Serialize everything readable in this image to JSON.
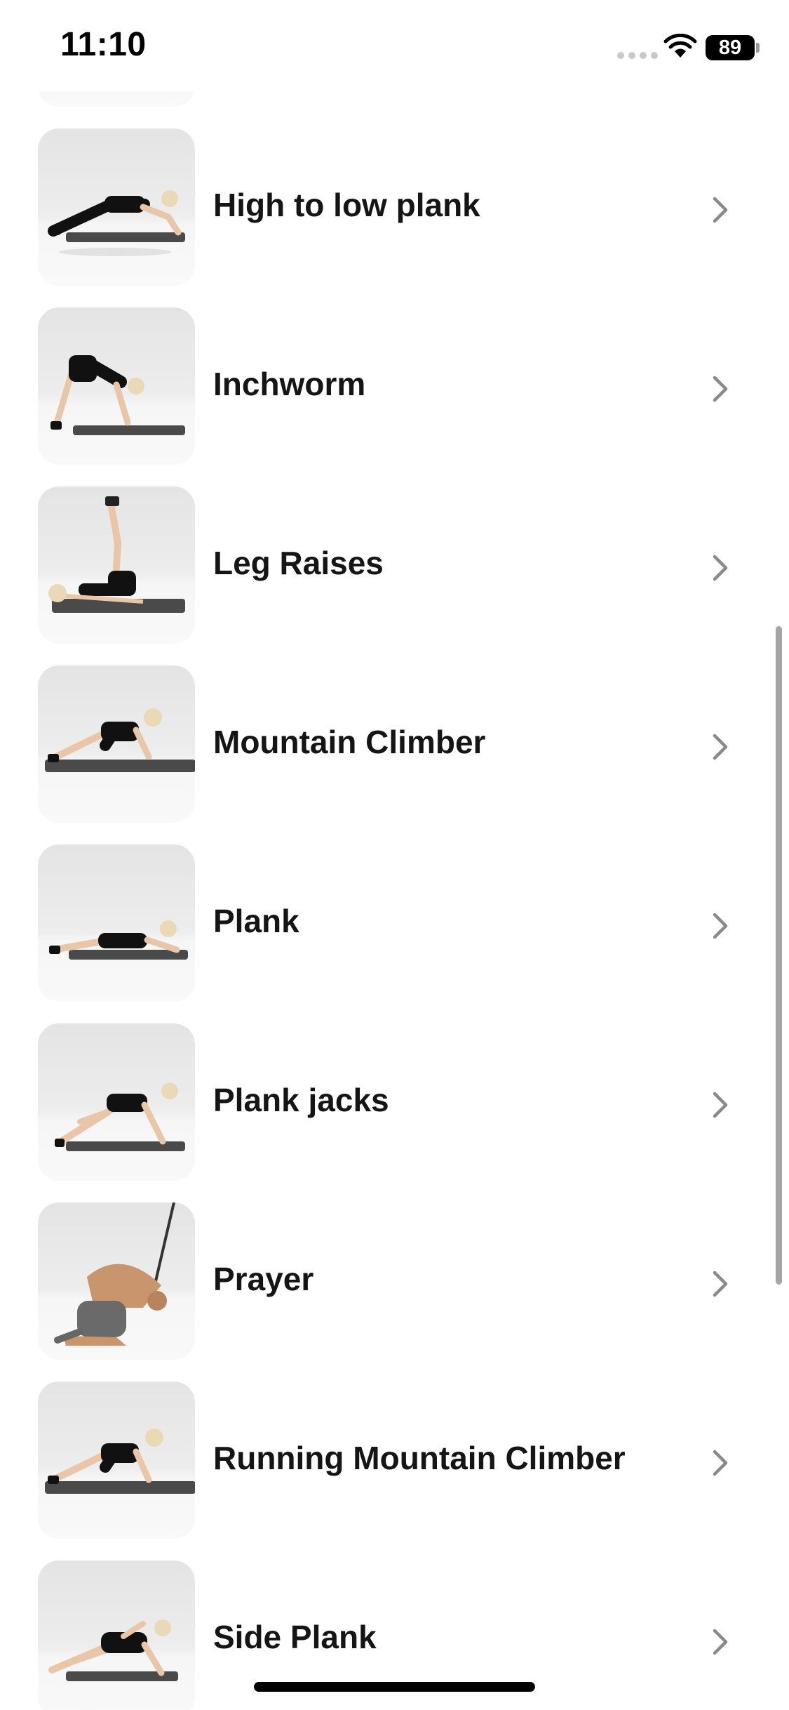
{
  "status_bar": {
    "time": "11:10",
    "battery_level": "89",
    "icons": [
      "signal-dots-icon",
      "wifi-icon",
      "battery-icon"
    ]
  },
  "exercises": [
    {
      "name": "",
      "thumbnail": "exercise-thumbnail"
    },
    {
      "name": "High to low plank",
      "thumbnail": "plank-pose-thumbnail"
    },
    {
      "name": "Inchworm",
      "thumbnail": "inchworm-pose-thumbnail"
    },
    {
      "name": "Leg Raises",
      "thumbnail": "leg-raise-pose-thumbnail"
    },
    {
      "name": "Mountain Climber",
      "thumbnail": "mountain-climber-pose-thumbnail"
    },
    {
      "name": "Plank",
      "thumbnail": "plank-pose-thumbnail"
    },
    {
      "name": "Plank jacks",
      "thumbnail": "plank-jacks-pose-thumbnail"
    },
    {
      "name": "Prayer",
      "thumbnail": "cable-crunch-pose-thumbnail"
    },
    {
      "name": "Running Mountain Climber",
      "thumbnail": "mountain-climber-pose-thumbnail"
    },
    {
      "name": "Side Plank",
      "thumbnail": "side-plank-pose-thumbnail"
    }
  ],
  "row_icon": "chevron-right-icon",
  "colors": {
    "text": "#151515",
    "chevron": "#8a8a8e",
    "thumbnail_bg": "#ececec"
  }
}
